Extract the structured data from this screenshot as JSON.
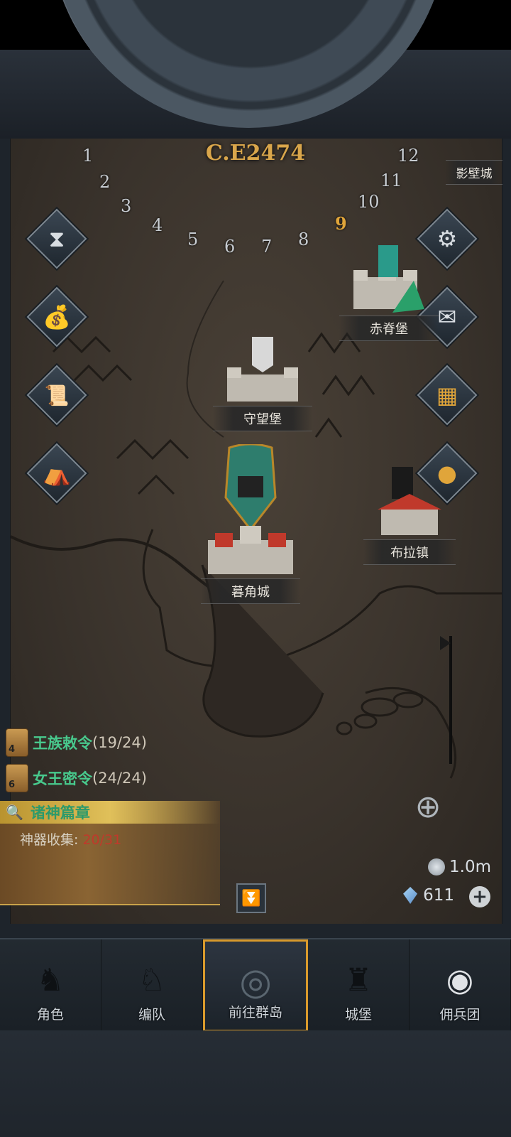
{
  "era": {
    "label": "C.E2474"
  },
  "dial": {
    "numbers": [
      "1",
      "2",
      "3",
      "4",
      "5",
      "6",
      "7",
      "8",
      "9",
      "10",
      "11",
      "12"
    ],
    "active_number": "9"
  },
  "side_buttons_left": [
    {
      "name": "hourglass-icon"
    },
    {
      "name": "money-bag-icon"
    },
    {
      "name": "scroll-map-icon"
    },
    {
      "name": "camp-flag-icon"
    }
  ],
  "side_buttons_right": [
    {
      "name": "gear-icon"
    },
    {
      "name": "mail-icon"
    },
    {
      "name": "grid-panel-icon"
    },
    {
      "name": "coin-icon"
    }
  ],
  "cities": {
    "top_right_partial": "影壁城",
    "red_ridge": "赤脊堡",
    "watch_fort": "守望堡",
    "dusk_horn": "暮角城",
    "bula": "布拉镇"
  },
  "quests": [
    {
      "badge": "4",
      "title": "王族敕令",
      "count": "(19/24)"
    },
    {
      "badge": "6",
      "title": "女王密令",
      "count": "(24/24)"
    }
  ],
  "event": {
    "title": "诸神篇章",
    "sub_label": "神器收集:",
    "sub_value": "20/31"
  },
  "currency": {
    "silver": "1.0m",
    "gems": "611"
  },
  "bottom_nav": [
    {
      "label": "角色",
      "icon": "knight-helmet-icon"
    },
    {
      "label": "编队",
      "icon": "horse-knight-icon"
    },
    {
      "label": "前往群岛",
      "icon": "compass-icon"
    },
    {
      "label": "城堡",
      "icon": "castle-icon"
    },
    {
      "label": "佣兵团",
      "icon": "mercenary-emblem-icon"
    }
  ],
  "colors": {
    "accent_gold": "#d99a2c",
    "quest_green": "#48c98d",
    "progress_red": "#c0392b"
  }
}
